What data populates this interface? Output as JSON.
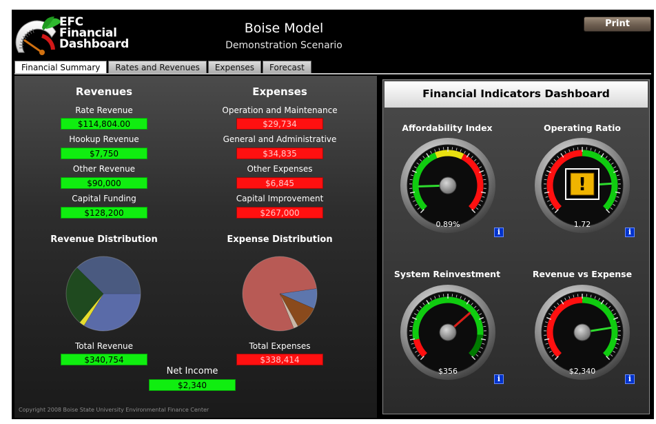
{
  "header": {
    "logo_text_1": "EFC",
    "logo_text_2": "Financial",
    "logo_text_3": "Dashboard",
    "title": "Boise Model",
    "subtitle": "Demonstration Scenario",
    "print_label": "Print"
  },
  "tabs": [
    {
      "label": "Financial Summary",
      "active": true
    },
    {
      "label": "Rates and Revenues",
      "active": false
    },
    {
      "label": "Expenses",
      "active": false
    },
    {
      "label": "Forecast",
      "active": false
    }
  ],
  "revenues": {
    "heading": "Revenues",
    "items": [
      {
        "label": "Rate Revenue",
        "value": "$114,804.00"
      },
      {
        "label": "Hookup Revenue",
        "value": "$7,750"
      },
      {
        "label": "Other Revenue",
        "value": "$90,000"
      },
      {
        "label": "Capital Funding",
        "value": "$128,200"
      }
    ]
  },
  "expenses": {
    "heading": "Expenses",
    "items": [
      {
        "label": "Operation and Maintenance",
        "value": "$29,734"
      },
      {
        "label": "General and Administrative",
        "value": "$34,835"
      },
      {
        "label": "Other Expenses",
        "value": "$6,845"
      },
      {
        "label": "Capital Improvement",
        "value": "$267,000"
      }
    ]
  },
  "revenue_distribution": {
    "heading": "Revenue Distribution",
    "total_label": "Total Revenue",
    "total_value": "$340,754",
    "slices": [
      {
        "value": 114804,
        "color": "#5a6ba8"
      },
      {
        "value": 7750,
        "color": "#e6dd2e"
      },
      {
        "value": 90000,
        "color": "#1f4a1f"
      },
      {
        "value": 128200,
        "color": "#4a5a80"
      }
    ]
  },
  "expense_distribution": {
    "heading": "Expense Distribution",
    "total_label": "Total Expenses",
    "total_value": "$338,414",
    "slices": [
      {
        "value": 29734,
        "color": "#5d76ad"
      },
      {
        "value": 34835,
        "color": "#8a4a1c"
      },
      {
        "value": 6845,
        "color": "#c9b8a8"
      },
      {
        "value": 267000,
        "color": "#b85a55"
      }
    ]
  },
  "net_income": {
    "label": "Net Income",
    "value": "$2,340"
  },
  "copyright": "Copyright 2008 Boise State University Environmental Finance Center",
  "indicators": {
    "heading": "Financial Indicators Dashboard",
    "gauges": [
      {
        "title": "Affordability Index",
        "value": "0.89%",
        "needle": 0.16,
        "warning": false,
        "bands": [
          [
            "#10cc10",
            0.0,
            0.42
          ],
          [
            "#e8e010",
            0.42,
            0.6
          ],
          [
            "#ff1010",
            0.6,
            1.0
          ]
        ]
      },
      {
        "title": "Operating Ratio",
        "value": "1.72",
        "needle": 0.82,
        "warning": true,
        "bands": [
          [
            "#ff1010",
            0.0,
            0.5
          ],
          [
            "#10cc10",
            0.5,
            1.0
          ]
        ]
      },
      {
        "title": "System Reinvestment",
        "value": "$356",
        "needle": 0.68,
        "warning": false,
        "bands": [
          [
            "#ff1010",
            0.0,
            0.12
          ],
          [
            "#10cc10",
            0.12,
            0.85
          ],
          [
            "#007a00",
            0.85,
            1.0
          ]
        ]
      },
      {
        "title": "Revenue vs Expense",
        "value": "$2,340",
        "needle": 0.8,
        "warning": false,
        "bands": [
          [
            "#ff1010",
            0.0,
            0.5
          ],
          [
            "#10cc10",
            0.5,
            1.0
          ]
        ]
      }
    ]
  }
}
